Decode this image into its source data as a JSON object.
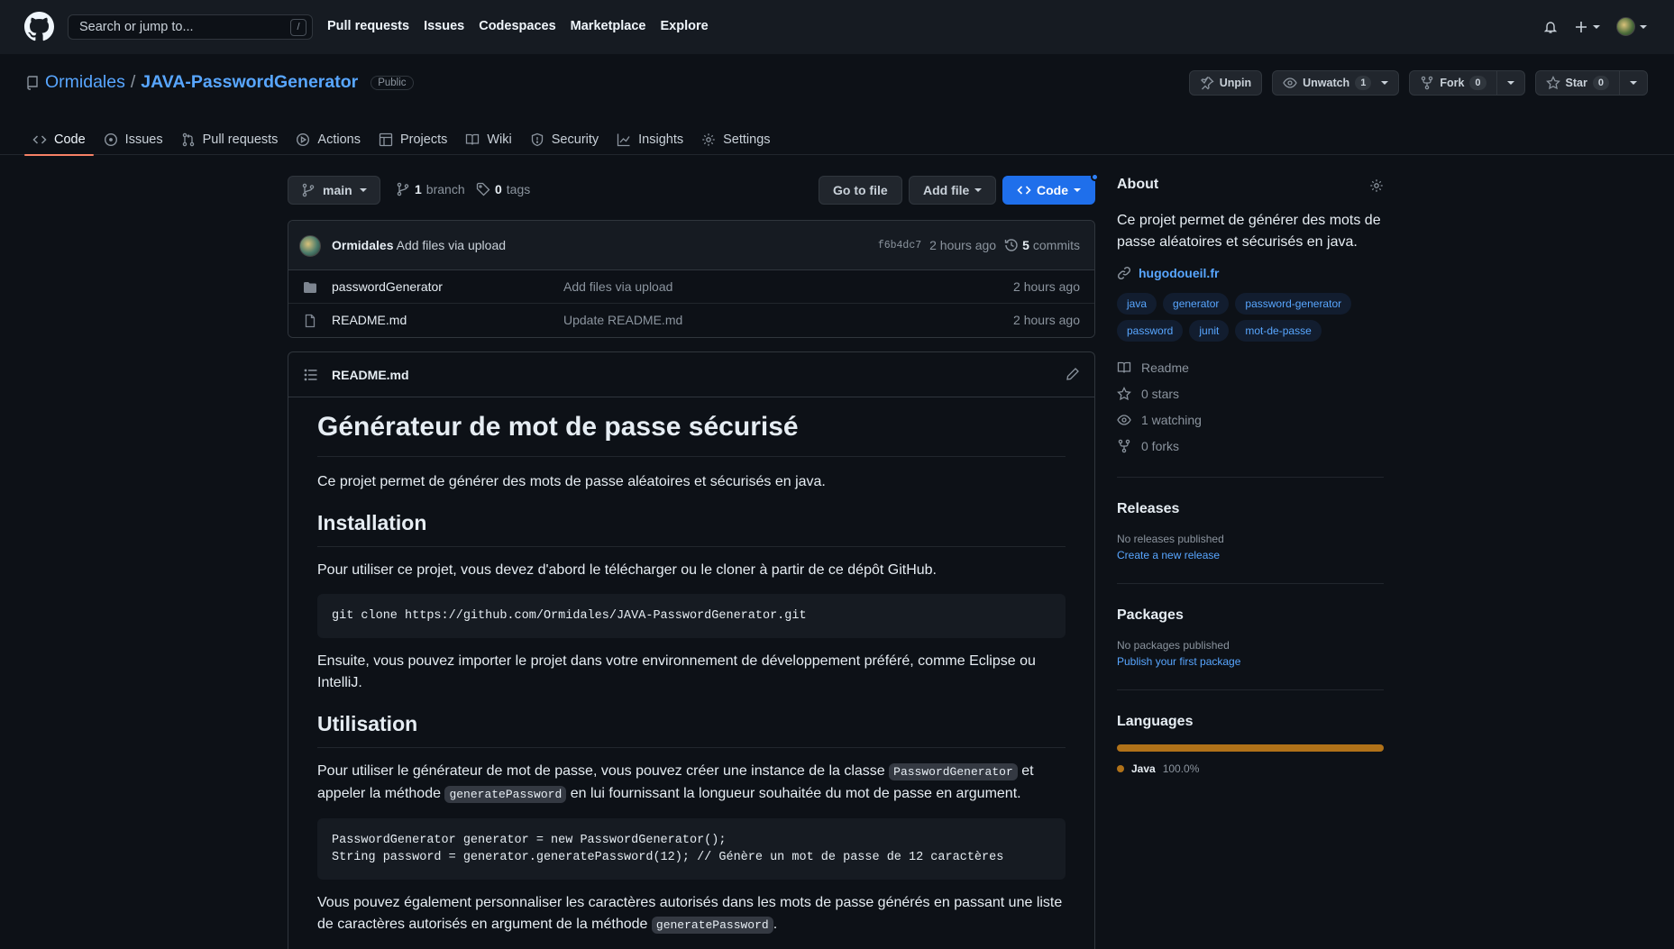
{
  "header": {
    "search_placeholder": "Search or jump to...",
    "search_shortcut": "/",
    "nav": [
      "Pull requests",
      "Issues",
      "Codespaces",
      "Marketplace",
      "Explore"
    ]
  },
  "repo": {
    "owner": "Ormidales",
    "separator": "/",
    "name": "JAVA-PasswordGenerator",
    "visibility": "Public",
    "unpin_label": "Unpin",
    "unwatch_label": "Unwatch",
    "watch_count": "1",
    "fork_label": "Fork",
    "fork_count": "0",
    "star_label": "Star",
    "star_count": "0"
  },
  "tabs": [
    {
      "label": "Code",
      "icon": "code-icon"
    },
    {
      "label": "Issues",
      "icon": "issue-icon"
    },
    {
      "label": "Pull requests",
      "icon": "pull-request-icon"
    },
    {
      "label": "Actions",
      "icon": "play-icon"
    },
    {
      "label": "Projects",
      "icon": "table-icon"
    },
    {
      "label": "Wiki",
      "icon": "book-icon"
    },
    {
      "label": "Security",
      "icon": "shield-icon"
    },
    {
      "label": "Insights",
      "icon": "graph-icon"
    },
    {
      "label": "Settings",
      "icon": "gear-icon"
    }
  ],
  "branchbar": {
    "branch": "main",
    "branch_count": "1",
    "branch_label": "branch",
    "tag_count": "0",
    "tag_label": "tags",
    "go_to_file": "Go to file",
    "add_file": "Add file",
    "code": "Code"
  },
  "commit": {
    "author": "Ormidales",
    "message": "Add files via upload",
    "sha": "f6b4dc7",
    "age": "2 hours ago",
    "commit_count": "5",
    "commit_label": "commits"
  },
  "files": [
    {
      "type": "folder",
      "name": "passwordGenerator",
      "commit": "Add files via upload",
      "age": "2 hours ago"
    },
    {
      "type": "file",
      "name": "README.md",
      "commit": "Update README.md",
      "age": "2 hours ago"
    }
  ],
  "readme": {
    "filename": "README.md",
    "h1": "Générateur de mot de passe sécurisé",
    "intro": "Ce projet permet de générer des mots de passe aléatoires et sécurisés en java.",
    "h2_install": "Installation",
    "install_text": "Pour utiliser ce projet, vous devez d'abord le télécharger ou le cloner à partir de ce dépôt GitHub.",
    "clone_cmd": "git clone https://github.com/Ormidales/JAVA-PasswordGenerator.git",
    "import_text": "Ensuite, vous pouvez importer le projet dans votre environnement de développement préféré, comme Eclipse ou IntelliJ.",
    "h2_usage": "Utilisation",
    "usage_a": "Pour utiliser le générateur de mot de passe, vous pouvez créer une instance de la classe ",
    "usage_code1": "PasswordGenerator",
    "usage_b": " et appeler la méthode ",
    "usage_code2": "generatePassword",
    "usage_c": " en lui fournissant la longueur souhaitée du mot de passe en argument.",
    "code_line1": "PasswordGenerator generator = new PasswordGenerator();",
    "code_line2": "String password = generator.generatePassword(12); // Génère un mot de passe de 12 caractères",
    "custom_a": "Vous pouvez également personnaliser les caractères autorisés dans les mots de passe générés en passant une liste de caractères autorisés en argument de la méthode ",
    "custom_code": "generatePassword",
    "custom_b": "."
  },
  "about": {
    "title": "About",
    "description": "Ce projet permet de générer des mots de passe aléatoires et sécurisés en java.",
    "website": "hugodoueil.fr",
    "topics": [
      "java",
      "generator",
      "password-generator",
      "password",
      "junit",
      "mot-de-passe"
    ],
    "stats": [
      {
        "icon": "book-icon",
        "label": "Readme"
      },
      {
        "icon": "star-icon",
        "label": "0 stars"
      },
      {
        "icon": "eye-icon",
        "label": "1 watching"
      },
      {
        "icon": "fork-icon",
        "label": "0 forks"
      }
    ]
  },
  "releases": {
    "title": "Releases",
    "empty": "No releases published",
    "link": "Create a new release"
  },
  "packages": {
    "title": "Packages",
    "empty": "No packages published",
    "link": "Publish your first package"
  },
  "languages": {
    "title": "Languages",
    "items": [
      {
        "name": "Java",
        "percent_label": "100.0%",
        "percent": 100,
        "color": "#b07219"
      }
    ]
  },
  "colors": {
    "accent": "#58a6ff",
    "primary_button": "#1f6feb",
    "tab_underline": "#f78166",
    "java": "#b07219"
  }
}
